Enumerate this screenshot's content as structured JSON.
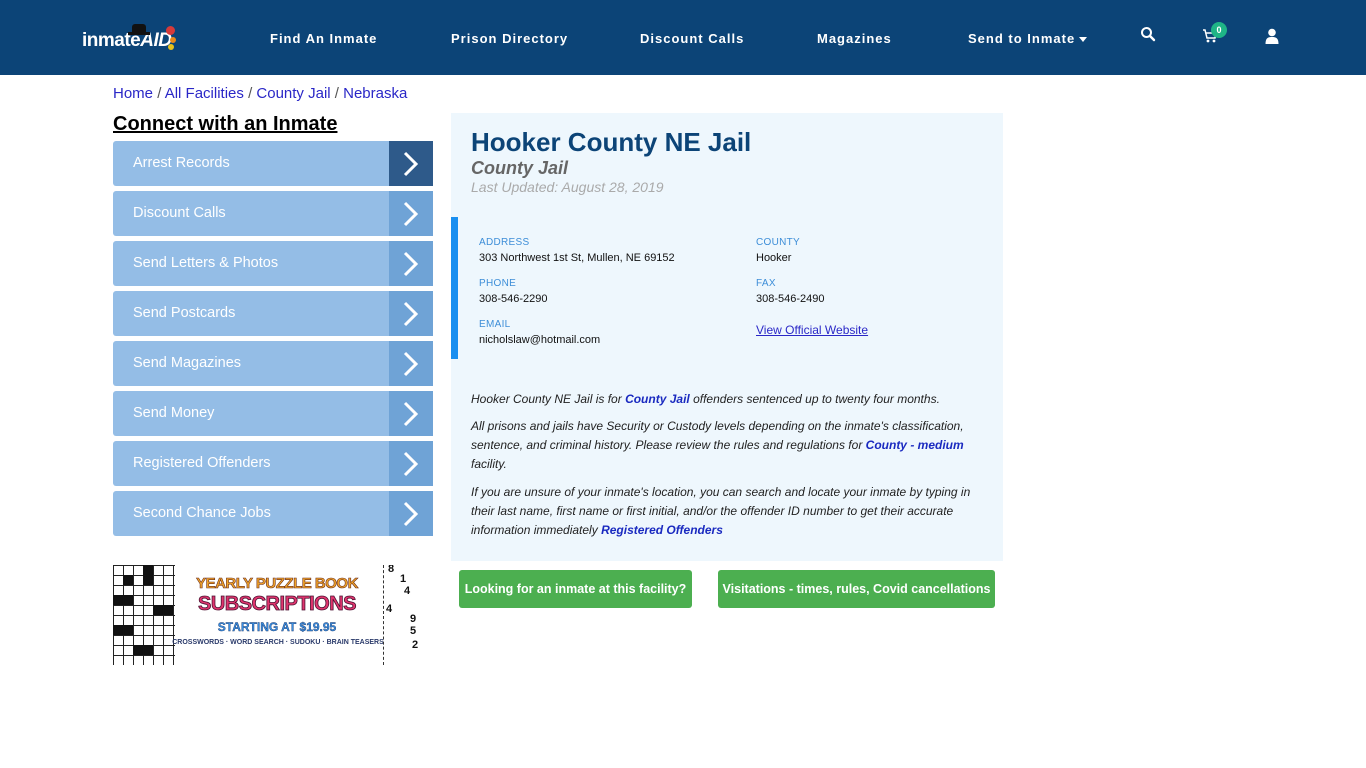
{
  "header": {
    "logo": {
      "text_main": "inmate",
      "text_accent": "AID"
    },
    "nav": [
      {
        "label": "Find An Inmate"
      },
      {
        "label": "Prison Directory"
      },
      {
        "label": "Discount Calls"
      },
      {
        "label": "Magazines"
      },
      {
        "label": "Send to Inmate",
        "has_dropdown": true
      }
    ],
    "icons": {
      "search": "search-icon",
      "cart": "cart-icon",
      "user": "user-icon"
    },
    "cart_count": "0"
  },
  "breadcrumb": [
    {
      "label": "Home"
    },
    {
      "label": "All Facilities"
    },
    {
      "label": "County Jail"
    },
    {
      "label": "Nebraska"
    }
  ],
  "breadcrumb_separator": "/",
  "sidebar": {
    "title": "Connect with an Inmate",
    "items": [
      {
        "label": "Arrest Records"
      },
      {
        "label": "Discount Calls"
      },
      {
        "label": "Send Letters & Photos"
      },
      {
        "label": "Send Postcards"
      },
      {
        "label": "Send Magazines"
      },
      {
        "label": "Send Money"
      },
      {
        "label": "Registered Offenders"
      },
      {
        "label": "Second Chance Jobs"
      }
    ],
    "ad": {
      "line1": "YEARLY PUZZLE BOOK",
      "line2": "SUBSCRIPTIONS",
      "line3": "STARTING AT $19.95",
      "line4": "CROSSWORDS · WORD SEARCH · SUDOKU · BRAIN TEASERS",
      "sudoku_digits": [
        "8",
        "1",
        "4",
        "4",
        "9",
        "5",
        "2"
      ]
    }
  },
  "facility": {
    "name": "Hooker County NE Jail",
    "type": "County Jail",
    "last_updated": "Last Updated: August 28, 2019",
    "address_label": "ADDRESS",
    "address": "303 Northwest 1st St, Mullen, NE 69152",
    "county_label": "COUNTY",
    "county": "Hooker",
    "phone_label": "PHONE",
    "phone": "308-546-2290",
    "fax_label": "FAX",
    "fax": "308-546-2490",
    "email_label": "EMAIL",
    "email": "nicholslaw@hotmail.com",
    "website_link": "View Official Website",
    "desc1_a": "Hooker County NE Jail is for ",
    "desc1_link": "County Jail",
    "desc1_b": " offenders sentenced up to twenty four months.",
    "desc2_a": "All prisons and jails have Security or Custody levels depending on the inmate's classification, sentence, and criminal history. Please review the rules and regulations for ",
    "desc2_link": "County - medium",
    "desc2_b": " facility.",
    "desc3_a": "If you are unsure of your inmate's location, you can search and locate your inmate by typing in their last name, first name or first initial, and/or the offender ID number to get their accurate information immediately ",
    "desc3_link": "Registered Offenders"
  },
  "buttons": {
    "find_inmate": "Looking for an inmate at this facility?",
    "visitation": "Visitations - times, rules, Covid cancellations"
  },
  "colors": {
    "header_bg": "#0c4477",
    "sidebar_item": "#94bde6",
    "sidebar_arrow": "#6fa3d6",
    "sidebar_arrow_active": "#2e5a8a",
    "card_bg": "#eef7fd",
    "info_accent": "#1a8ff0",
    "green_button": "#4caf50",
    "title": "#0c4477",
    "link": "#2a27c7"
  }
}
